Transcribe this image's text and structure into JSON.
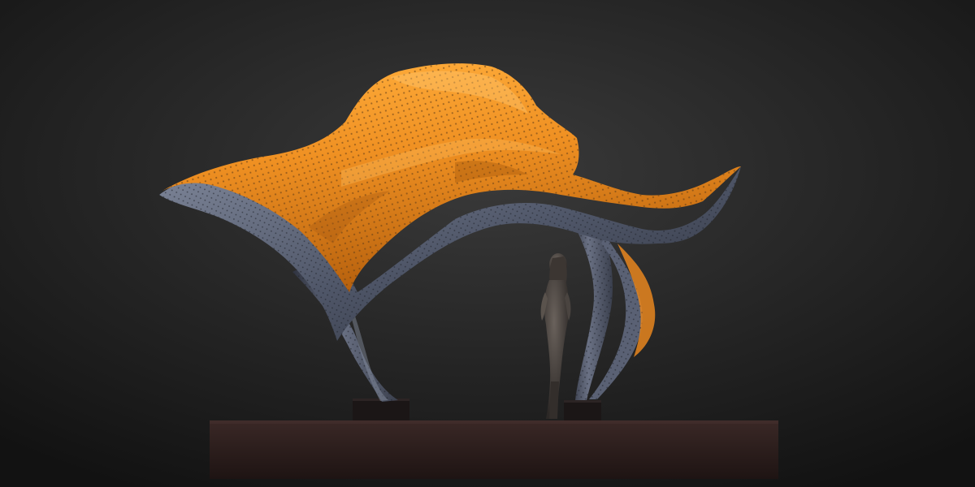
{
  "scene": {
    "background_top": "#3a3a3a",
    "background_bottom": "#121212",
    "canopy_top_color": "#ef9022",
    "canopy_top_highlight": "#ffae3c",
    "canopy_top_shadow": "#b8620e",
    "canopy_under_color": "#4f5668",
    "canopy_under_highlight": "#7e8699",
    "canopy_under_shadow": "#2b2f3a",
    "texture_dot_color": "#5d3a18",
    "figure_color": "#4a4440",
    "plinth_color": "#2a1c1a",
    "plinth_top_color": "#3a2826",
    "pedestal_color": "#1b1616"
  },
  "icons": [
    "canopy-sculpture-icon",
    "standing-figure-icon"
  ]
}
